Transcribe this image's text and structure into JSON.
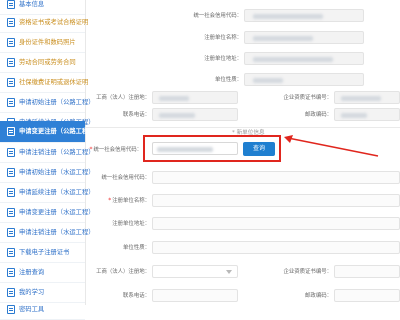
{
  "sidebar": {
    "items": [
      {
        "label": "基本信息",
        "style": "blue"
      },
      {
        "label": "资格证书或考试合格证明",
        "style": "gold"
      },
      {
        "label": "身份证件和数码照片",
        "style": "gold"
      },
      {
        "label": "劳动合同或劳务合同",
        "style": "gold"
      },
      {
        "label": "社保缴费证明或退休证明",
        "style": "gold"
      },
      {
        "label": "申请初始注册（公路工程）",
        "style": "blue"
      },
      {
        "label": "申请延续注册（公路工程）",
        "style": "blue"
      },
      {
        "label": "申请变更注册（公路工程）",
        "style": "active"
      },
      {
        "label": "申请注销注册（公路工程）",
        "style": "blue"
      },
      {
        "label": "申请初始注册（水运工程）",
        "style": "blue"
      },
      {
        "label": "申请延续注册（水运工程）",
        "style": "blue"
      },
      {
        "label": "申请变更注册（水运工程）",
        "style": "blue"
      },
      {
        "label": "申请注销注册（水运工程）",
        "style": "blue"
      },
      {
        "label": "下载电子注册证书",
        "style": "blue"
      },
      {
        "label": "注册查询",
        "style": "blue"
      },
      {
        "label": "我的学习",
        "style": "blue"
      },
      {
        "label": "密码工具",
        "style": "blue"
      }
    ]
  },
  "top_form": {
    "credit_code_label": "统一社会信用代码：",
    "unit_name_label": "注册单位名称：",
    "unit_address_label": "注册单位地址：",
    "unit_nature_label": "单位性质：",
    "legal_rep_label": "工商（法人）注册地：",
    "enterprise_cert_label": "企业资质证书编号：",
    "contact_phone_label": "联系电话：",
    "postcode_label": "邮政编码："
  },
  "section_title": "* 新单位信息",
  "new_unit": {
    "credit_code_label": "统一社会信用代码：",
    "credit_code_value": "",
    "query_button": "查询",
    "credit_code_label2": "统一社会信用代码：",
    "unit_name_label": "注册单位名称：",
    "unit_address_label": "注册单位地址：",
    "unit_nature_label": "单位性质：",
    "legal_rep_label": "工商（法人）注册地：",
    "legal_rep_value": "",
    "enterprise_cert_label": "企业资质证书编号：",
    "contact_phone_label": "联系电话：",
    "postcode_label": "邮政编码："
  },
  "colors": {
    "sidebar_active_bg": "#2f80d6",
    "sidebar_gold_text": "#c98d1c",
    "sidebar_blue_text": "#2c6fc8",
    "query_button_bg": "#1f7fd0",
    "highlight_red": "#e0261e"
  }
}
